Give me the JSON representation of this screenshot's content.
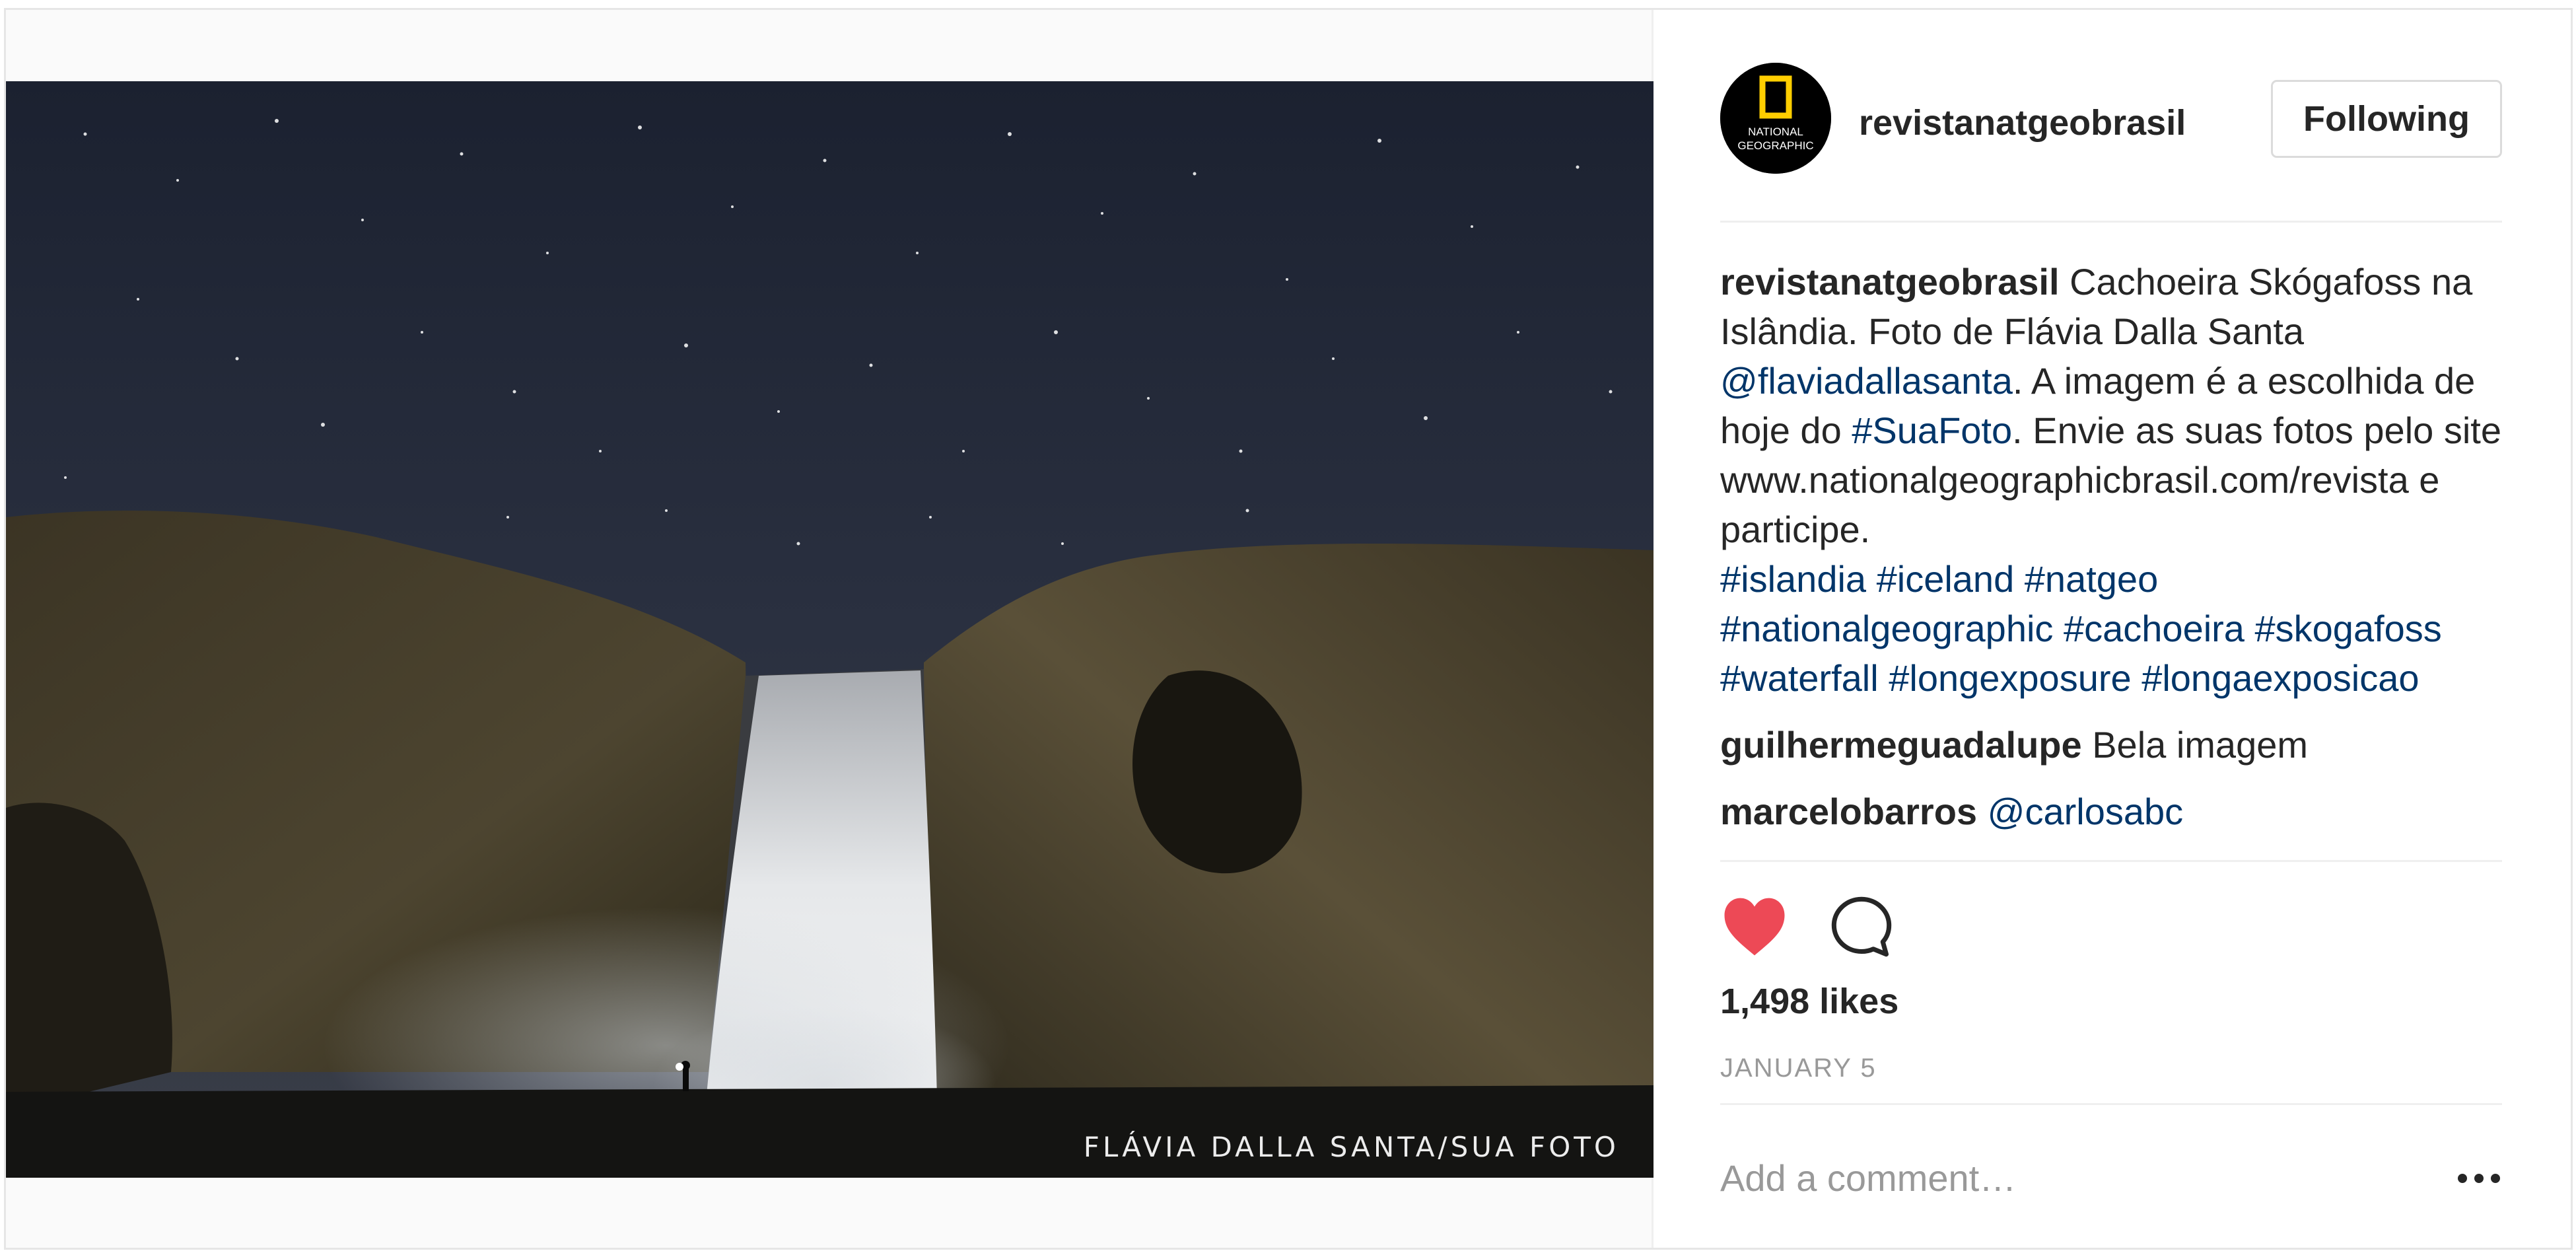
{
  "post": {
    "photo": {
      "alt": "",
      "credit": "FLÁVIA DALLA SANTA/SUA FOTO"
    },
    "header": {
      "avatar_text": [
        "NATIONAL",
        "GEOGRAPHIC"
      ],
      "username": "revistanatgeobrasil",
      "follow_label": "Following"
    },
    "caption": {
      "username": "revistanatgeobrasil",
      "text1": " Cachoeira Skógafoss na Islândia. Foto de Flávia Dalla Santa ",
      "mention": "@flaviadallasanta",
      "text2": ". A imagem é a escolhida de hoje do ",
      "hashtag1": "#SuaFoto",
      "text3": ". Envie as suas fotos pelo site www.nationalgeographicbrasil.com/revista e participe.",
      "hashtags": [
        "#islandia",
        "#iceland",
        "#natgeo",
        "#nationalgeographic",
        "#cachoeira",
        "#skogafoss",
        "#waterfall",
        "#longexposure",
        "#longaexposicao"
      ]
    },
    "comments": [
      {
        "username": "guilhermeguadalupe",
        "text": "Bela imagem"
      },
      {
        "username": "marcelobarros",
        "text": "@carlosabc"
      }
    ],
    "actions": {
      "heart_icon": "heart-filled-icon",
      "comment_icon": "speech-bubble-icon",
      "heart_color": "#ed4956"
    },
    "likes": "1,498 likes",
    "date": "JANUARY 5",
    "add_comment": {
      "placeholder": "Add a comment…",
      "more_icon": "ellipsis-icon"
    }
  },
  "colors": {
    "link": "#003569",
    "text": "#262626",
    "muted": "#999999",
    "border": "#efefef"
  }
}
